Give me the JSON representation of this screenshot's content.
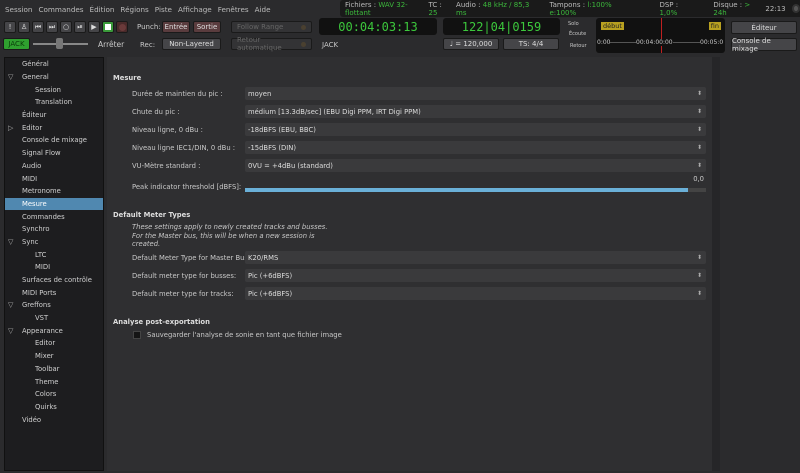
{
  "menu": [
    "Session",
    "Commandes",
    "Édition",
    "Régions",
    "Piste",
    "Affichage",
    "Fenêtres",
    "Aide"
  ],
  "status": {
    "files_label": "Fichiers :",
    "files": "WAV 32-flottant",
    "tc_label": "TC :",
    "tc": "25",
    "audio_label": "Audio :",
    "audio": "48 kHz / 85,3 ms",
    "buffers_label": "Tampons :",
    "buffers": "l:100% e:100%",
    "dsp_label": "DSP :",
    "dsp": "1,0%",
    "disk_label": "Disque :",
    "disk": "> 24h",
    "time": "22:13"
  },
  "transport": {
    "punch_label": "Punch:",
    "punch_in": "Entrée",
    "punch_out": "Sortie",
    "rec_label": "Rec:",
    "rec_mode": "Non-Layered",
    "follow_range": "Follow Range",
    "auto_return": "Retour automatique",
    "jack_button": "JACK",
    "stop_label": "Arrêter",
    "shuttle_position": 0.35
  },
  "clocks": {
    "primary": "00:04:03:13",
    "primary_label": "JACK",
    "secondary": "122|04|0159",
    "tempo": "♩ = 120,000",
    "meter": "TS: 4/4"
  },
  "monitor": {
    "solo": "Solo",
    "listen": "Écoute",
    "return": "Retour"
  },
  "mini_timeline": {
    "start": "début",
    "end": "fin",
    "t0": "0:00",
    "t1": "00:04:00:00",
    "t2": "00:05:0"
  },
  "buttons": {
    "editor": "Éditeur",
    "mixer": "Console de mixage"
  },
  "sidebar": [
    {
      "label": "Général",
      "lvl": 0
    },
    {
      "label": "General",
      "lvl": 0,
      "arrow": "open"
    },
    {
      "label": "Session",
      "lvl": 2
    },
    {
      "label": "Translation",
      "lvl": 2
    },
    {
      "label": "Éditeur",
      "lvl": 0
    },
    {
      "label": "Editor",
      "lvl": 0,
      "arrow": "closed"
    },
    {
      "label": "Console de mixage",
      "lvl": 0
    },
    {
      "label": "Signal Flow",
      "lvl": 0
    },
    {
      "label": "Audio",
      "lvl": 0
    },
    {
      "label": "MIDI",
      "lvl": 0
    },
    {
      "label": "Metronome",
      "lvl": 0
    },
    {
      "label": "Mesure",
      "lvl": 0,
      "selected": true
    },
    {
      "label": "Commandes",
      "lvl": 0
    },
    {
      "label": "Synchro",
      "lvl": 0
    },
    {
      "label": "Sync",
      "lvl": 0,
      "arrow": "open"
    },
    {
      "label": "LTC",
      "lvl": 2
    },
    {
      "label": "MIDI",
      "lvl": 2
    },
    {
      "label": "Surfaces de contrôle",
      "lvl": 0
    },
    {
      "label": "MIDI Ports",
      "lvl": 0
    },
    {
      "label": "Greffons",
      "lvl": 0,
      "arrow": "open"
    },
    {
      "label": "VST",
      "lvl": 2
    },
    {
      "label": "Appearance",
      "lvl": 0,
      "arrow": "open"
    },
    {
      "label": "Editor",
      "lvl": 2
    },
    {
      "label": "Mixer",
      "lvl": 2
    },
    {
      "label": "Toolbar",
      "lvl": 2
    },
    {
      "label": "Theme",
      "lvl": 2
    },
    {
      "label": "Colors",
      "lvl": 2
    },
    {
      "label": "Quirks",
      "lvl": 2
    },
    {
      "label": "Vidéo",
      "lvl": 0
    }
  ],
  "mesure": {
    "title": "Mesure",
    "rows": [
      {
        "label": "Durée de maintien du pic :",
        "value": "moyen"
      },
      {
        "label": "Chute du pic :",
        "value": "médium [13.3dB/sec] (EBU Digi PPM, IRT Digi PPM)"
      },
      {
        "label": "Niveau ligne, 0 dBu :",
        "value": "-18dBFS (EBU, BBC)"
      },
      {
        "label": "Niveau ligne IEC1/DIN, 0 dBu :",
        "value": "-15dBFS (DIN)"
      },
      {
        "label": "VU-Mètre standard :",
        "value": "0VU = +4dBu (standard)"
      }
    ],
    "peak_label": "Peak indicator threshold [dBFS]:",
    "peak_value": "0,0",
    "peak_fraction": 1.0
  },
  "meter_types": {
    "title": "Default Meter Types",
    "note": "These settings apply to newly created tracks and busses. For the Master bus, this will be when a new session is created.",
    "rows": [
      {
        "label": "Default Meter Type for Master Bus:",
        "value": "K20/RMS"
      },
      {
        "label": "Default meter type for busses:",
        "value": "Pic (+6dBFS)"
      },
      {
        "label": "Default meter type for tracks:",
        "value": "Pic (+6dBFS)"
      }
    ]
  },
  "export": {
    "title": "Analyse post-exportation",
    "checkbox": "Sauvegarder l'analyse de sonie en tant que fichier image",
    "checked": false
  }
}
